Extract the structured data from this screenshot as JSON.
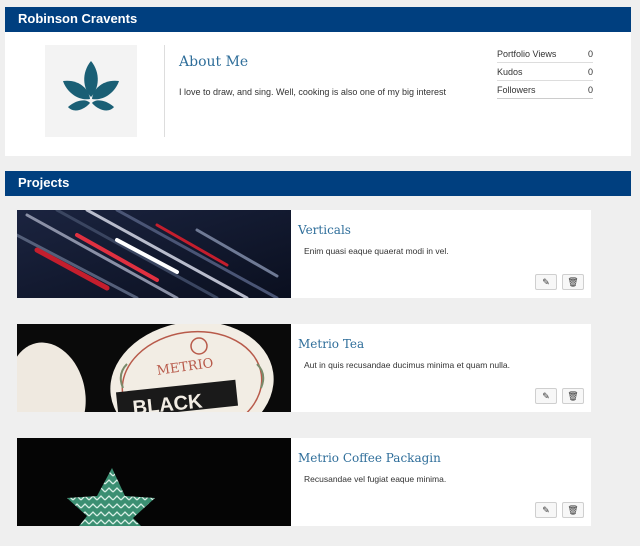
{
  "profile": {
    "name": "Robinson Cravents",
    "about_title": "About Me",
    "about_text": "I love to draw, and sing. Well, cooking is also one of my big interest",
    "avatar_icon": "leaf-logo-icon",
    "stats": [
      {
        "label": "Portfolio Views",
        "value": "0"
      },
      {
        "label": "Kudos",
        "value": "0"
      },
      {
        "label": "Followers",
        "value": "0"
      }
    ]
  },
  "projects": {
    "header": "Projects",
    "items": [
      {
        "title": "Verticals",
        "description": "Enim quasi eaque quaerat modi in vel."
      },
      {
        "title": "Metrio Tea",
        "description": "Aut in quis recusandae ducimus minima et quam nulla."
      },
      {
        "title": "Metrio Coffee Packagin",
        "description": "Recusandae vel fugiat eaque minima."
      }
    ],
    "edit_icon": "pencil-icon",
    "delete_icon": "trash-icon"
  },
  "colors": {
    "header_bar": "#003f7f",
    "title_text": "#2f6e9a",
    "logo": "#1a5f75"
  }
}
